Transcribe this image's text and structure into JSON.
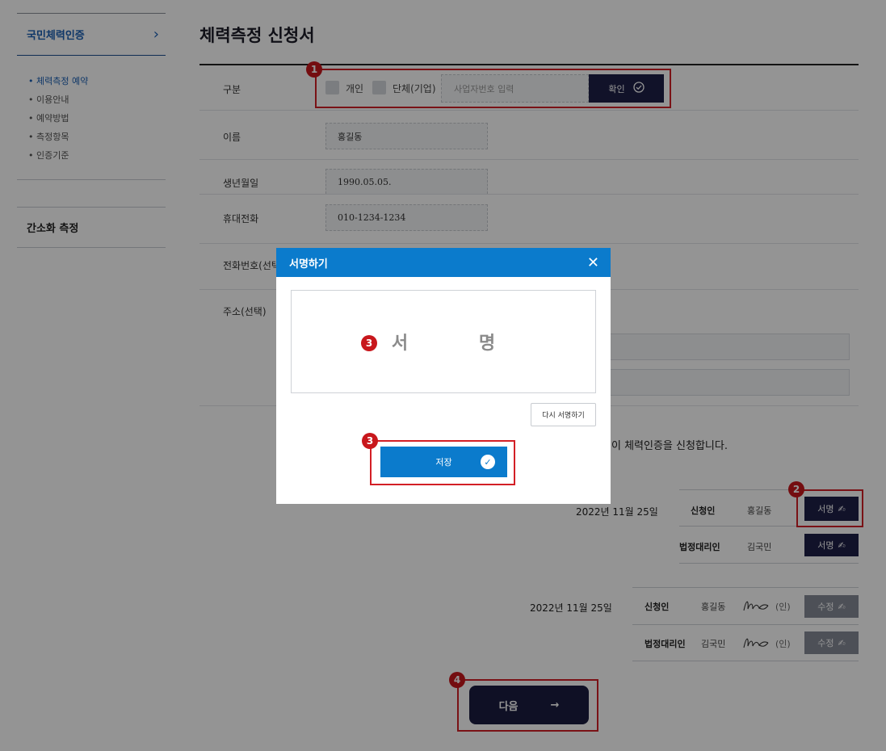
{
  "sidebar": {
    "section_title": "국민체력인증",
    "sub_items": [
      {
        "label": "• 체력측정 예약"
      },
      {
        "label": "• 이용안내"
      },
      {
        "label": "• 예약방법"
      },
      {
        "label": "• 측정항목"
      },
      {
        "label": "• 인증기준"
      }
    ],
    "section2_title": "간소화 측정"
  },
  "page": {
    "title": "체력측정 신청서"
  },
  "form": {
    "category_label": "구분",
    "personal_label": "개인",
    "group_label": "단체(기업)",
    "biz_placeholder": "사업자번호 입력",
    "confirm_label": "확인",
    "name_label": "이름",
    "name_value": "홍길동",
    "birth_label": "생년월일",
    "birth_value": "1990.05.05.",
    "mobile_label": "휴대전화",
    "mobile_value": "010-1234-1234",
    "phone_label": "전화번호(선택)",
    "address_label": "주소(선택)"
  },
  "agreement_text": "이 체력인증을 신청합니다.",
  "signature_top": {
    "date": "2022년 11월 25일",
    "rows": [
      {
        "role": "신청인",
        "name": "홍길동",
        "button": "서명"
      },
      {
        "role": "법정대리인",
        "name": "김국민",
        "button": "서명"
      }
    ]
  },
  "signature_bottom": {
    "date": "2022년 11월 25일",
    "seal": "(인)",
    "rows": [
      {
        "role": "신청인",
        "name": "홍길동",
        "button": "수정"
      },
      {
        "role": "법정대리인",
        "name": "김국민",
        "button": "수정"
      }
    ]
  },
  "next_button": "다음",
  "modal": {
    "title": "서명하기",
    "pad_label": "서 명",
    "resign_label": "다시 서명하기",
    "save_label": "저장"
  },
  "annotations": {
    "b1": "1",
    "b2": "2",
    "b3a": "3",
    "b3b": "3",
    "b4": "4"
  },
  "colors": {
    "accent_blue": "#0b7bcc",
    "navy": "#1e2048",
    "highlight_red": "#d31f26"
  }
}
